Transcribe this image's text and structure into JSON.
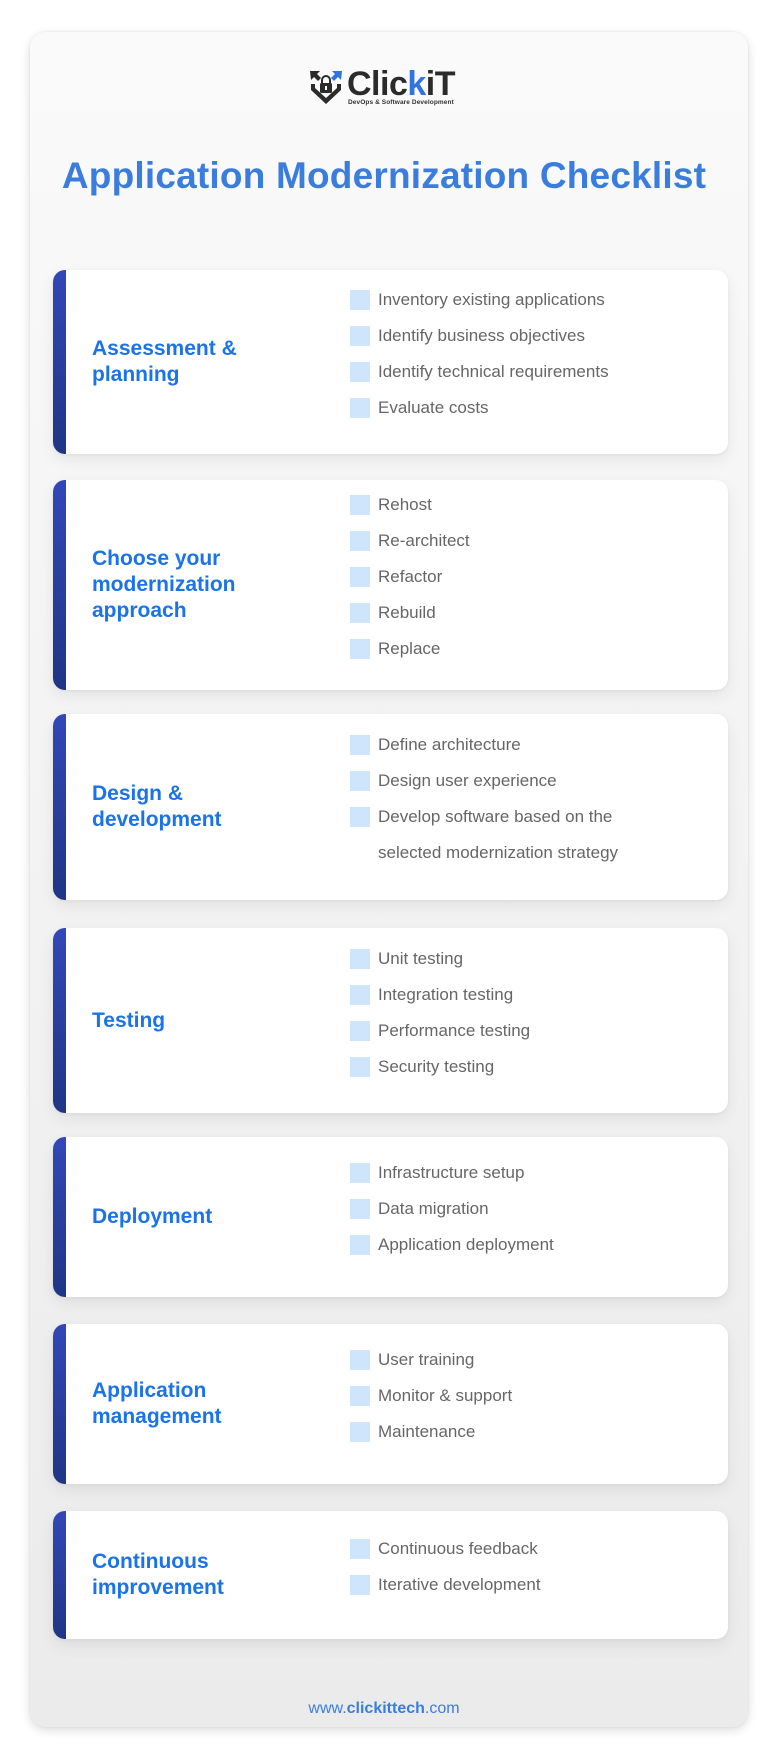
{
  "logo": {
    "brand_prefix": "Clic",
    "brand_highlight": "k",
    "brand_suffix": "iT",
    "tagline": "DevOps & Software Development",
    "icon": "shield-lock-icon"
  },
  "title": "Application Modernization Checklist",
  "colors": {
    "title": "#3b7ddd",
    "heading": "#1a73e8",
    "bar": "#2a3ea3",
    "checkbox": "#cfe5fb",
    "item_text": "#666666"
  },
  "sections": [
    {
      "heading": "Assessment & planning",
      "items": [
        "Inventory existing applications",
        "Identify business objectives",
        "Identify technical requirements",
        "Evaluate costs"
      ]
    },
    {
      "heading": "Choose your modernization approach",
      "items": [
        "Rehost",
        "Re-architect",
        "Refactor",
        "Rebuild",
        "Replace"
      ]
    },
    {
      "heading": "Design & development",
      "items": [
        "Define architecture",
        "Design user experience",
        "Develop software based on the selected modernization strategy"
      ]
    },
    {
      "heading": "Testing",
      "items": [
        "Unit testing",
        "Integration testing",
        "Performance testing",
        "Security testing"
      ]
    },
    {
      "heading": "Deployment",
      "items": [
        "Infrastructure setup",
        "Data migration",
        "Application deployment"
      ]
    },
    {
      "heading": "Application management",
      "items": [
        "User training",
        "Monitor & support",
        "Maintenance"
      ]
    },
    {
      "heading": "Continuous improvement",
      "items": [
        "Continuous feedback",
        "Iterative development"
      ]
    }
  ],
  "footer": {
    "prefix": "www.",
    "domain": "clickittech",
    "suffix": ".com"
  }
}
